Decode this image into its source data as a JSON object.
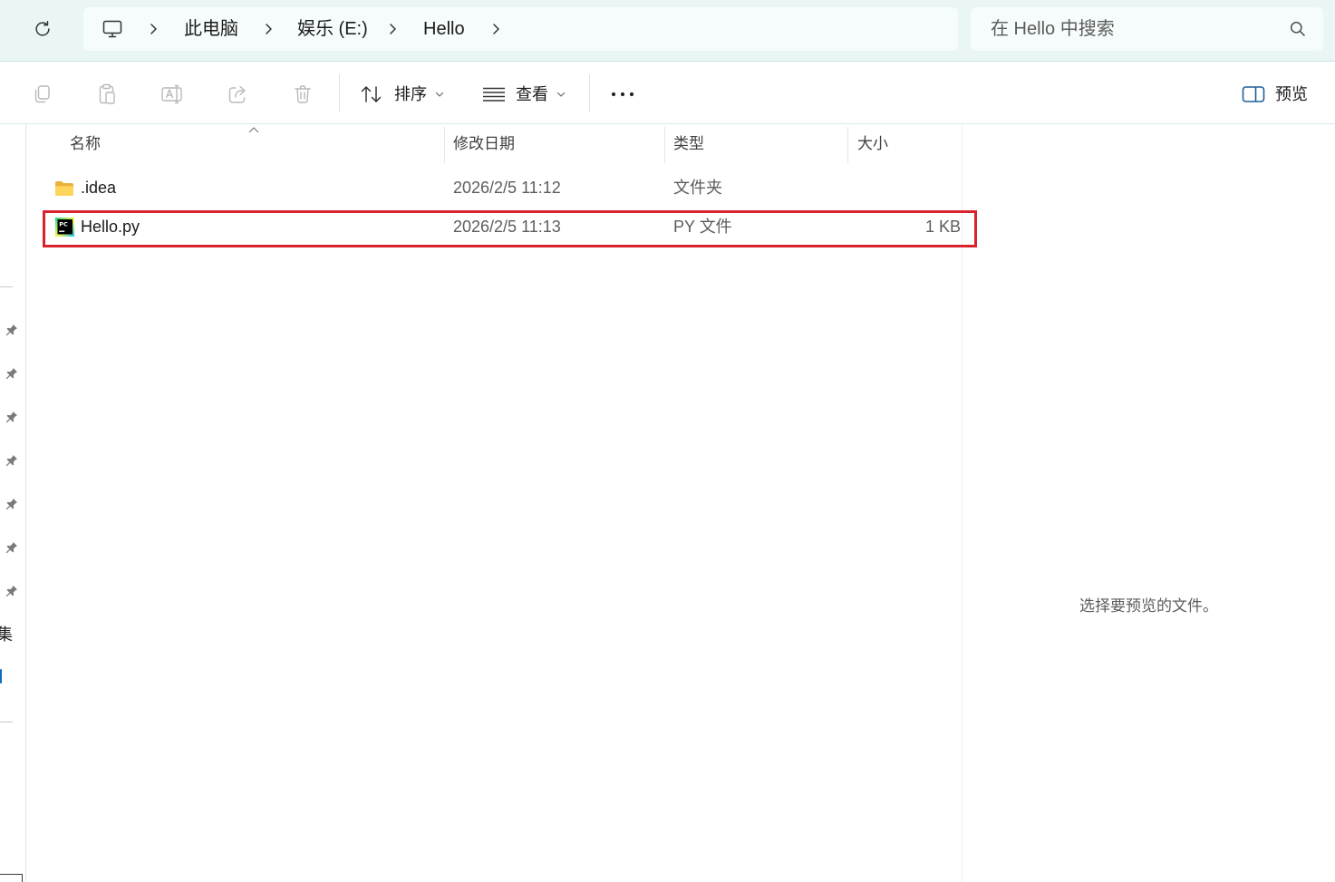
{
  "colors": {
    "header_bg": "#eaf6f6",
    "address_bg": "#f6fbfb",
    "disabled_icon": "#b9b9b9",
    "accent": "#1f5f99",
    "folder": "#f5c242",
    "highlight_border": "#d9232d",
    "secondary_text": "#5c5c5c"
  },
  "navigation": {
    "refresh_icon": "refresh-icon",
    "location_icon": "monitor-icon",
    "separator_icon": "chevron-right-icon",
    "breadcrumbs": [
      {
        "label": "此电脑"
      },
      {
        "label": "娱乐 (E:)"
      },
      {
        "label": "Hello"
      }
    ]
  },
  "search": {
    "placeholder": "在 Hello 中搜索",
    "value": "",
    "icon": "search-icon"
  },
  "toolbar": {
    "actions": [
      {
        "icon": "copy-icon",
        "enabled": false
      },
      {
        "icon": "paste-icon",
        "enabled": false
      },
      {
        "icon": "rename-icon",
        "enabled": false
      },
      {
        "icon": "share-icon",
        "enabled": false
      },
      {
        "icon": "delete-icon",
        "enabled": false
      }
    ],
    "sort": {
      "label": "排序",
      "icon": "sort-icon"
    },
    "view": {
      "label": "查看",
      "icon": "view-list-icon"
    },
    "more": {
      "icon": "more-icon"
    },
    "preview": {
      "label": "预览",
      "icon": "preview-pane-icon",
      "active": true
    }
  },
  "nav_pane": {
    "visible_labels": [
      "集"
    ],
    "pin_icon": "pin-icon"
  },
  "file_list": {
    "sort_indicator_icon": "sort-ascending-icon",
    "columns": [
      {
        "label": "名称"
      },
      {
        "label": "修改日期"
      },
      {
        "label": "类型"
      },
      {
        "label": "大小"
      }
    ],
    "items": [
      {
        "name": ".idea",
        "modified": "2026/2/5 11:12",
        "type": "文件夹",
        "size": "",
        "icon": "folder-icon",
        "highlighted": false
      },
      {
        "name": "Hello.py",
        "modified": "2026/2/5 11:13",
        "type": "PY 文件",
        "size": "1 KB",
        "icon": "pycharm-file-icon",
        "icon_logo_text": "PC",
        "highlighted": true
      }
    ]
  },
  "preview_pane": {
    "message": "选择要预览的文件。"
  }
}
